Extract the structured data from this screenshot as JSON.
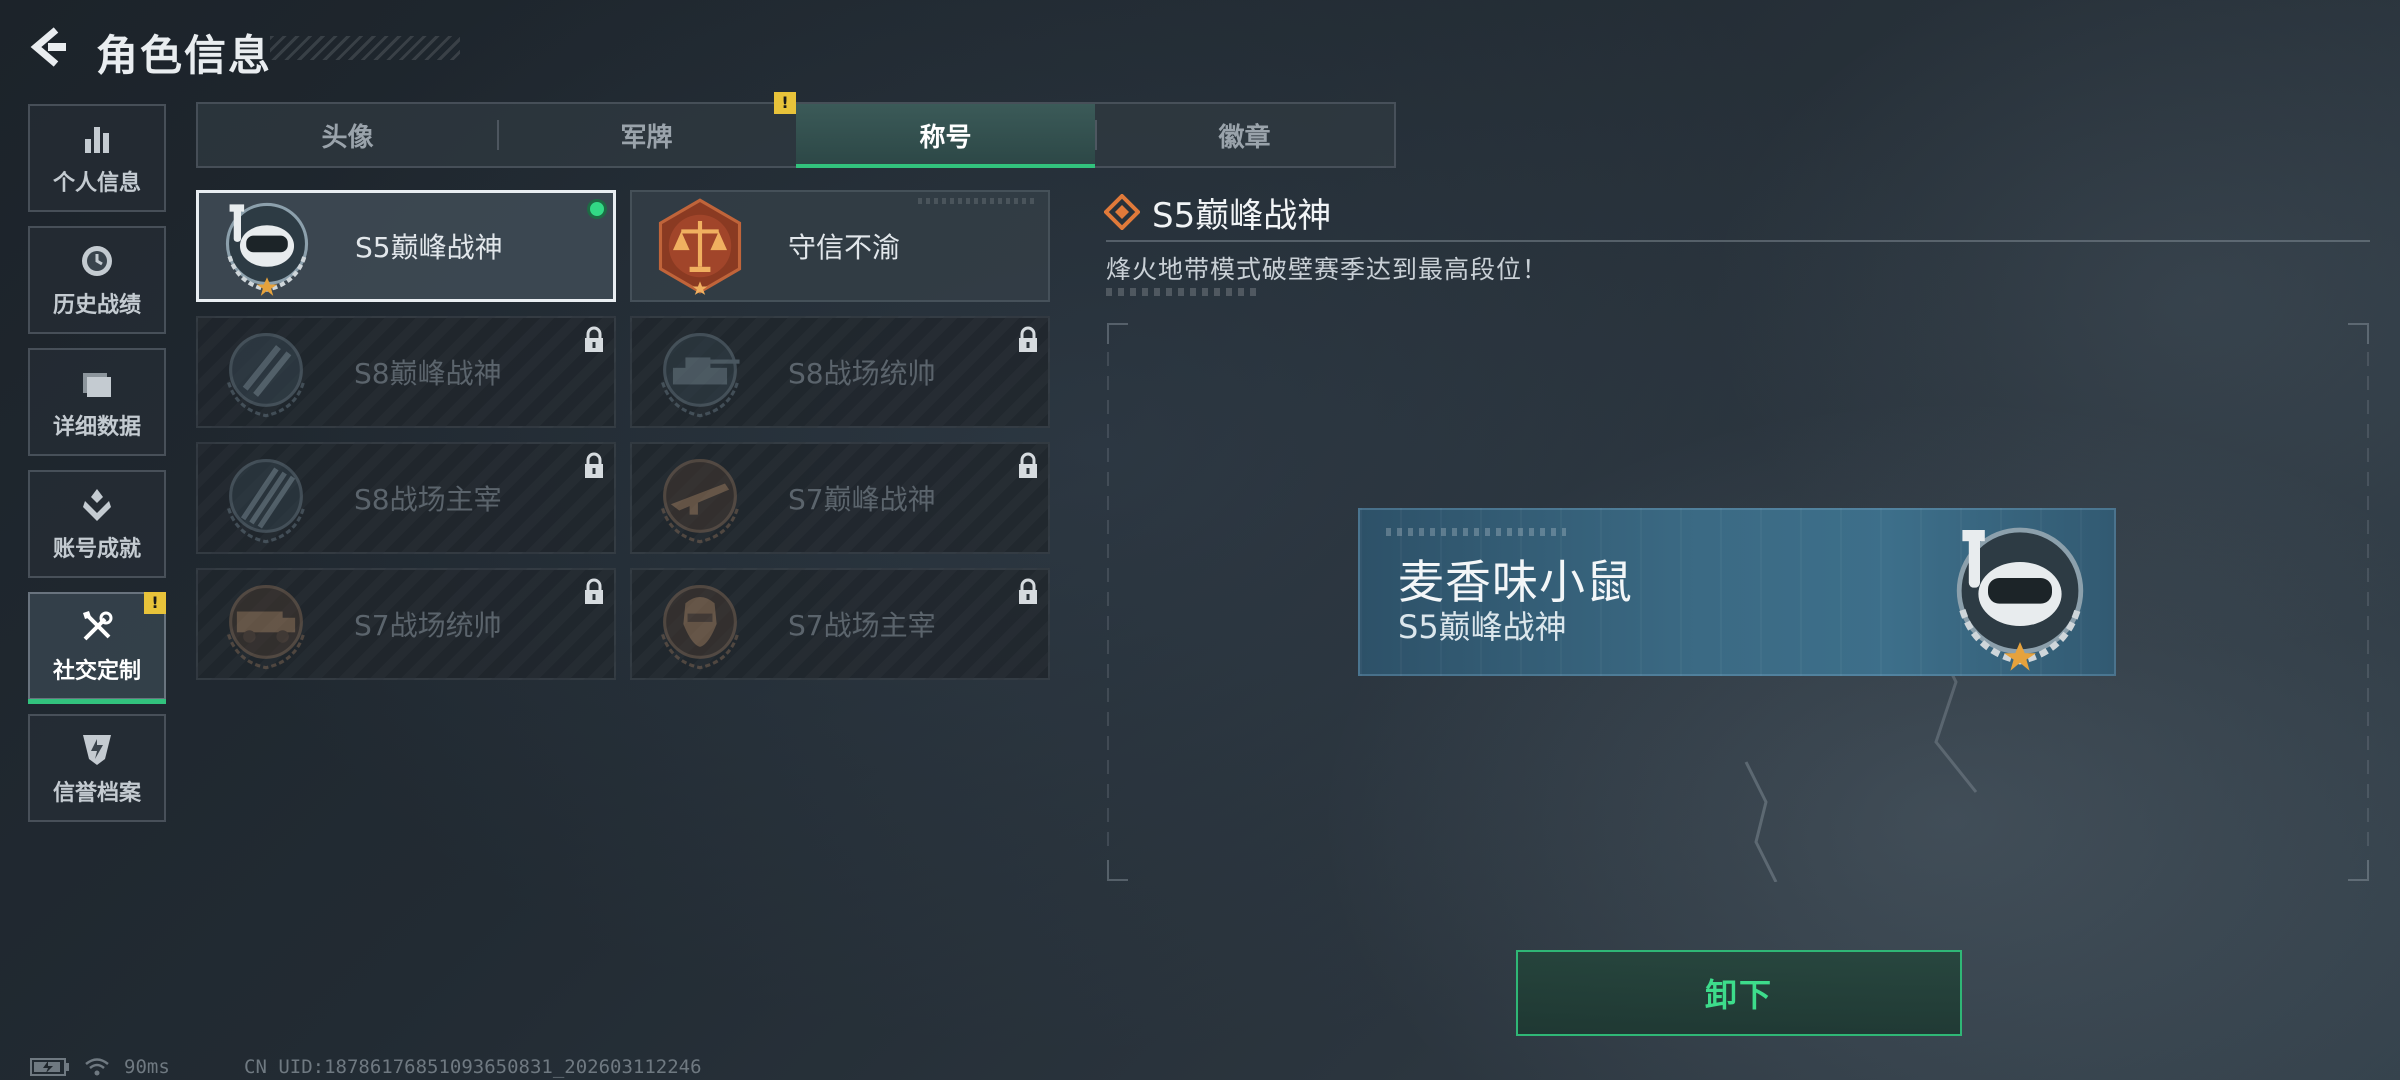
{
  "header": {
    "title": "角色信息"
  },
  "nav": {
    "items": [
      {
        "label": "个人信息",
        "icon": "bar-chart-icon"
      },
      {
        "label": "历史战绩",
        "icon": "clock-icon"
      },
      {
        "label": "详细数据",
        "icon": "folder-icon"
      },
      {
        "label": "账号成就",
        "icon": "achievement-icon"
      },
      {
        "label": "社交定制",
        "icon": "tools-icon",
        "active": true,
        "badge": "!"
      },
      {
        "label": "信誉档案",
        "icon": "shield-icon"
      }
    ]
  },
  "tabs": [
    {
      "label": "头像"
    },
    {
      "label": "军牌",
      "badge": "!"
    },
    {
      "label": "称号",
      "active": true
    },
    {
      "label": "徽章"
    }
  ],
  "titles": [
    {
      "label": "S5巅峰战神",
      "state": "equipped",
      "icon": "diver-mask-emblem-icon"
    },
    {
      "label": "守信不渝",
      "state": "unlocked",
      "icon": "scales-emblem-icon"
    },
    {
      "label": "S8巅峰战神",
      "state": "locked",
      "icon": "slash-emblem-icon"
    },
    {
      "label": "S8战场统帅",
      "state": "locked",
      "icon": "tank-emblem-icon"
    },
    {
      "label": "S8战场主宰",
      "state": "locked",
      "icon": "missile-emblem-icon"
    },
    {
      "label": "S7巅峰战神",
      "state": "locked",
      "icon": "rifle-emblem-icon"
    },
    {
      "label": "S7战场统帅",
      "state": "locked",
      "icon": "truck-emblem-icon"
    },
    {
      "label": "S7战场主宰",
      "state": "locked",
      "icon": "soldier-emblem-icon"
    }
  ],
  "detail": {
    "title": "S5巅峰战神",
    "description": "烽火地带模式破壁赛季达到最高段位！"
  },
  "nameplate": {
    "player_name": "麦香味小鼠",
    "title": "S5巅峰战神"
  },
  "actions": {
    "unequip_label": "卸下"
  },
  "status": {
    "latency": "90ms",
    "uid": "CN UID:18786176851093650831_202603112246"
  },
  "colors": {
    "accent_green": "#32c27d",
    "warning_yellow": "#e8c33a",
    "emblem_orange": "#e07a3a"
  }
}
